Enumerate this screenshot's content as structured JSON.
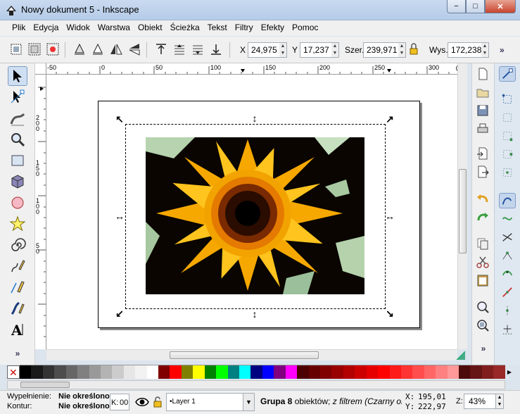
{
  "window": {
    "title": "Nowy dokument 5 - Inkscape",
    "minimize": "−",
    "maximize": "□",
    "close": "✕"
  },
  "menu": [
    {
      "label": "Plik"
    },
    {
      "label": "Edycja"
    },
    {
      "label": "Widok"
    },
    {
      "label": "Warstwa"
    },
    {
      "label": "Obiekt"
    },
    {
      "label": "Ścieżka"
    },
    {
      "label": "Tekst"
    },
    {
      "label": "Filtry"
    },
    {
      "label": "Efekty"
    },
    {
      "label": "Pomoc"
    }
  ],
  "controls": {
    "x_label": "X",
    "x_value": "24,975",
    "y_label": "Y",
    "y_value": "17,237",
    "w_label": "Szer.",
    "w_value": "239,971",
    "h_label": "Wys.",
    "h_value": "172,238",
    "overflow": "»"
  },
  "ruler_top": [
    "-50",
    "0",
    "50",
    "100",
    "150",
    "200",
    "250",
    "300"
  ],
  "ruler_left": [
    "2",
    "0",
    "0",
    "1",
    "5",
    "0",
    "1",
    "0",
    "0",
    "5",
    "0"
  ],
  "palette": {
    "no_paint": "✕",
    "swatches": [
      "#000000",
      "#1a1a1a",
      "#333333",
      "#4d4d4d",
      "#666666",
      "#808080",
      "#999999",
      "#b3b3b3",
      "#cccccc",
      "#e6e6e6",
      "#f2f2f2",
      "#ffffff",
      "#800000",
      "#ff0000",
      "#808000",
      "#ffff00",
      "#008000",
      "#00ff00",
      "#008080",
      "#00ffff",
      "#000080",
      "#0000ff",
      "#800080",
      "#ff00ff",
      "#4d0000",
      "#660000",
      "#800000",
      "#990000",
      "#b30000",
      "#cc0000",
      "#e60000",
      "#ff0000",
      "#ff1a1a",
      "#ff3333",
      "#ff4d4d",
      "#ff6666",
      "#ff8080",
      "#ff9999",
      "#4d0a0a",
      "#661414",
      "#801e1e",
      "#992828"
    ]
  },
  "status": {
    "fill_label": "Wypełnienie:",
    "fill_value": "Nie określono",
    "stroke_label": "Kontur:",
    "stroke_value": "Nie określono",
    "k_label": "K:",
    "k_value": "00",
    "layer": "•Layer 1",
    "message_bold": "Grupa 8",
    "message_rest": " obiektów; ",
    "message_italic": "z filtrem (Czarny ob",
    "x_label": "X:",
    "x_value": "195,01",
    "y_label": "Y:",
    "y_value": "222,97",
    "z_label": "Z:",
    "zoom": "43%"
  },
  "toolbox_overflow": "»",
  "cmd_overflow": "»"
}
